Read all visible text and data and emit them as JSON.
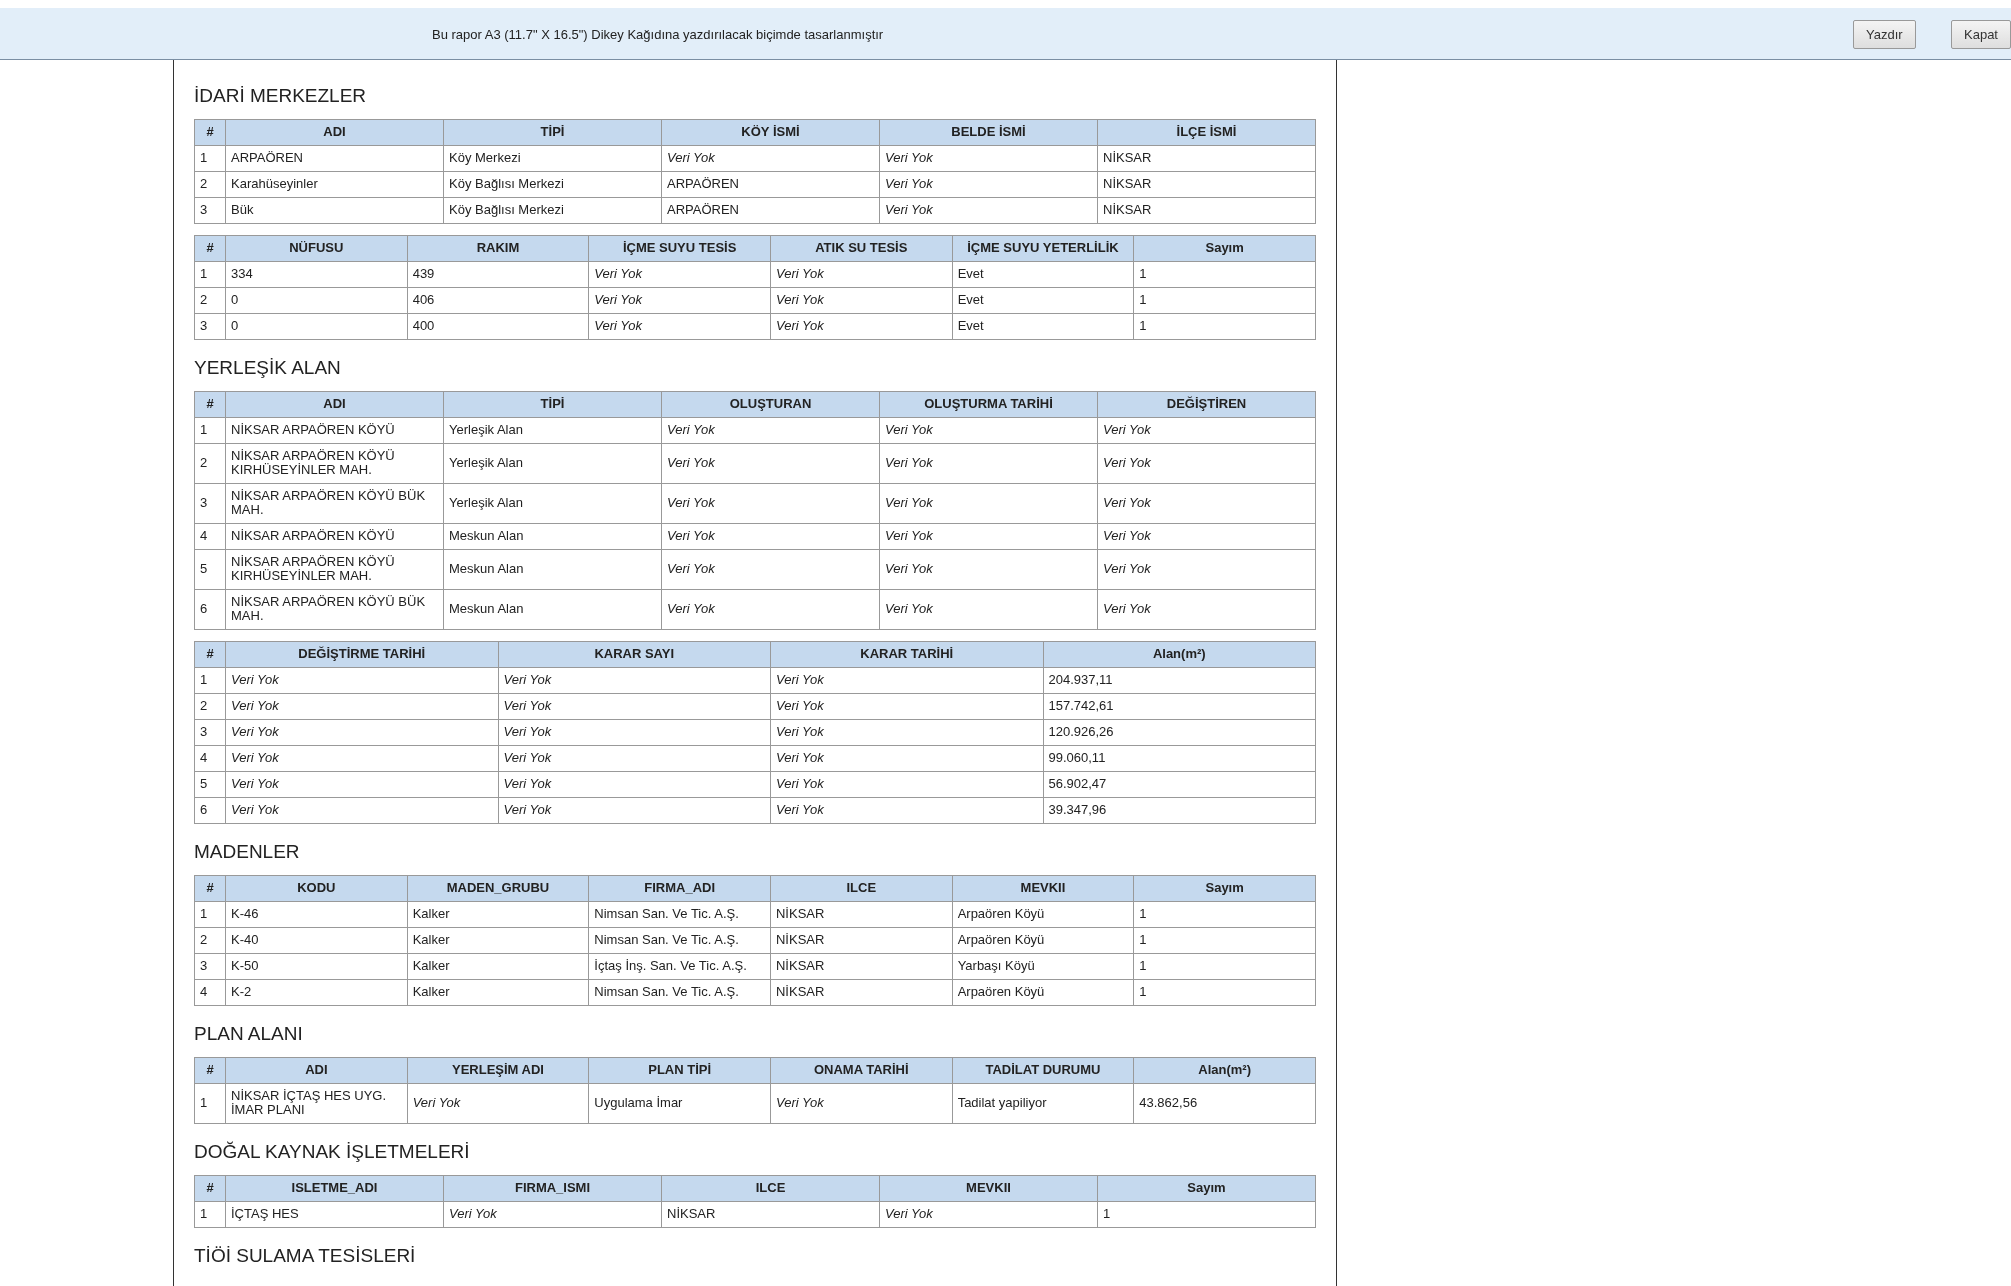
{
  "banner": {
    "message": "Bu rapor A3 (11.7\" X 16.5\") Dikey Kağıdına yazdırılacak biçimde tasarlanmıştır",
    "buttons": [
      "Yazdır",
      "Kapat"
    ]
  },
  "sections": [
    {
      "title": "İDARİ MERKEZLER",
      "tables": [
        {
          "columns": [
            "#",
            "ADI",
            "TİPİ",
            "KÖY İSMİ",
            "BELDE İSMİ",
            "İLÇE İSMİ"
          ],
          "rows": [
            [
              "1",
              "ARPAÖREN",
              "Köy Merkezi",
              {
                "text": "Veri Yok",
                "no_data": true
              },
              {
                "text": "Veri Yok",
                "no_data": true
              },
              "NİKSAR"
            ],
            [
              "2",
              "Karahüseyinler",
              "Köy Bağlısı Merkezi",
              "ARPAÖREN",
              {
                "text": "Veri Yok",
                "no_data": true
              },
              "NİKSAR"
            ],
            [
              "3",
              "Bük",
              "Köy Bağlısı Merkezi",
              "ARPAÖREN",
              {
                "text": "Veri Yok",
                "no_data": true
              },
              "NİKSAR"
            ]
          ]
        },
        {
          "columns": [
            "#",
            "NÜFUSU",
            "RAKIM",
            "İÇME SUYU TESİS",
            "ATIK SU TESİS",
            "İÇME SUYU YETERLİLİK",
            "Sayım"
          ],
          "rows": [
            [
              "1",
              "334",
              "439",
              {
                "text": "Veri Yok",
                "no_data": true
              },
              {
                "text": "Veri Yok",
                "no_data": true
              },
              "Evet",
              "1"
            ],
            [
              "2",
              "0",
              "406",
              {
                "text": "Veri Yok",
                "no_data": true
              },
              {
                "text": "Veri Yok",
                "no_data": true
              },
              "Evet",
              "1"
            ],
            [
              "3",
              "0",
              "400",
              {
                "text": "Veri Yok",
                "no_data": true
              },
              {
                "text": "Veri Yok",
                "no_data": true
              },
              "Evet",
              "1"
            ]
          ]
        }
      ]
    },
    {
      "title": "YERLEŞİK ALAN",
      "tables": [
        {
          "columns": [
            "#",
            "ADI",
            "TİPİ",
            "OLUŞTURAN",
            "OLUŞTURMA TARİHİ",
            "DEĞİŞTİREN"
          ],
          "rows": [
            [
              "1",
              "NİKSAR ARPAÖREN KÖYÜ",
              "Yerleşik Alan",
              {
                "text": "Veri Yok",
                "no_data": true
              },
              {
                "text": "Veri Yok",
                "no_data": true
              },
              {
                "text": "Veri Yok",
                "no_data": true
              }
            ],
            [
              "2",
              "NİKSAR ARPAÖREN KÖYÜ KIRHÜSEYİNLER MAH.",
              "Yerleşik Alan",
              {
                "text": "Veri Yok",
                "no_data": true
              },
              {
                "text": "Veri Yok",
                "no_data": true
              },
              {
                "text": "Veri Yok",
                "no_data": true
              }
            ],
            [
              "3",
              "NİKSAR ARPAÖREN KÖYÜ BÜK MAH.",
              "Yerleşik Alan",
              {
                "text": "Veri Yok",
                "no_data": true
              },
              {
                "text": "Veri Yok",
                "no_data": true
              },
              {
                "text": "Veri Yok",
                "no_data": true
              }
            ],
            [
              "4",
              "NİKSAR ARPAÖREN KÖYÜ",
              "Meskun Alan",
              {
                "text": "Veri Yok",
                "no_data": true
              },
              {
                "text": "Veri Yok",
                "no_data": true
              },
              {
                "text": "Veri Yok",
                "no_data": true
              }
            ],
            [
              "5",
              "NİKSAR ARPAÖREN KÖYÜ KIRHÜSEYİNLER MAH.",
              "Meskun Alan",
              {
                "text": "Veri Yok",
                "no_data": true
              },
              {
                "text": "Veri Yok",
                "no_data": true
              },
              {
                "text": "Veri Yok",
                "no_data": true
              }
            ],
            [
              "6",
              "NİKSAR ARPAÖREN KÖYÜ BÜK MAH.",
              "Meskun Alan",
              {
                "text": "Veri Yok",
                "no_data": true
              },
              {
                "text": "Veri Yok",
                "no_data": true
              },
              {
                "text": "Veri Yok",
                "no_data": true
              }
            ]
          ]
        },
        {
          "columns": [
            "#",
            "DEĞİŞTİRME TARİHİ",
            "KARAR SAYI",
            "KARAR TARİHİ",
            "Alan(m²)"
          ],
          "rows": [
            [
              "1",
              {
                "text": "Veri Yok",
                "no_data": true
              },
              {
                "text": "Veri Yok",
                "no_data": true
              },
              {
                "text": "Veri Yok",
                "no_data": true
              },
              "204.937,11"
            ],
            [
              "2",
              {
                "text": "Veri Yok",
                "no_data": true
              },
              {
                "text": "Veri Yok",
                "no_data": true
              },
              {
                "text": "Veri Yok",
                "no_data": true
              },
              "157.742,61"
            ],
            [
              "3",
              {
                "text": "Veri Yok",
                "no_data": true
              },
              {
                "text": "Veri Yok",
                "no_data": true
              },
              {
                "text": "Veri Yok",
                "no_data": true
              },
              "120.926,26"
            ],
            [
              "4",
              {
                "text": "Veri Yok",
                "no_data": true
              },
              {
                "text": "Veri Yok",
                "no_data": true
              },
              {
                "text": "Veri Yok",
                "no_data": true
              },
              "99.060,11"
            ],
            [
              "5",
              {
                "text": "Veri Yok",
                "no_data": true
              },
              {
                "text": "Veri Yok",
                "no_data": true
              },
              {
                "text": "Veri Yok",
                "no_data": true
              },
              "56.902,47"
            ],
            [
              "6",
              {
                "text": "Veri Yok",
                "no_data": true
              },
              {
                "text": "Veri Yok",
                "no_data": true
              },
              {
                "text": "Veri Yok",
                "no_data": true
              },
              "39.347,96"
            ]
          ]
        }
      ]
    },
    {
      "title": "MADENLER",
      "tables": [
        {
          "columns": [
            "#",
            "KODU",
            "MADEN_GRUBU",
            "FIRMA_ADI",
            "ILCE",
            "MEVKII",
            "Sayım"
          ],
          "rows": [
            [
              "1",
              "K-46",
              "Kalker",
              "Nimsan San. Ve Tic. A.Ş.",
              "NİKSAR",
              "Arpaören Köyü",
              "1"
            ],
            [
              "2",
              "K-40",
              "Kalker",
              "Nimsan San. Ve Tic. A.Ş.",
              "NİKSAR",
              "Arpaören Köyü",
              "1"
            ],
            [
              "3",
              "K-50",
              "Kalker",
              "İçtaş İnş. San. Ve Tic. A.Ş.",
              "NİKSAR",
              "Yarbaşı Köyü",
              "1"
            ],
            [
              "4",
              "K-2",
              "Kalker",
              "Nimsan San. Ve Tic. A.Ş.",
              "NİKSAR",
              "Arpaören Köyü",
              "1"
            ]
          ]
        }
      ]
    },
    {
      "title": "PLAN ALANI",
      "tables": [
        {
          "columns": [
            "#",
            "ADI",
            "YERLEŞİM ADI",
            "PLAN TİPİ",
            "ONAMA TARİHİ",
            "TADİLAT DURUMU",
            "Alan(m²)"
          ],
          "rows": [
            [
              "1",
              "NİKSAR İÇTAŞ HES UYG. İMAR PLANI",
              {
                "text": "Veri Yok",
                "no_data": true
              },
              "Uygulama İmar",
              {
                "text": "Veri Yok",
                "no_data": true
              },
              "Tadilat yapiliyor",
              "43.862,56"
            ]
          ]
        }
      ]
    },
    {
      "title": "DOĞAL KAYNAK İŞLETMELERİ",
      "tables": [
        {
          "columns": [
            "#",
            "ISLETME_ADI",
            "FIRMA_ISMI",
            "ILCE",
            "MEVKII",
            "Sayım"
          ],
          "rows": [
            [
              "1",
              "İÇTAŞ HES",
              {
                "text": "Veri Yok",
                "no_data": true
              },
              "NİKSAR",
              {
                "text": "Veri Yok",
                "no_data": true
              },
              "1"
            ]
          ]
        }
      ]
    },
    {
      "title": "TİÖİ SULAMA TESİSLERİ"
    }
  ]
}
